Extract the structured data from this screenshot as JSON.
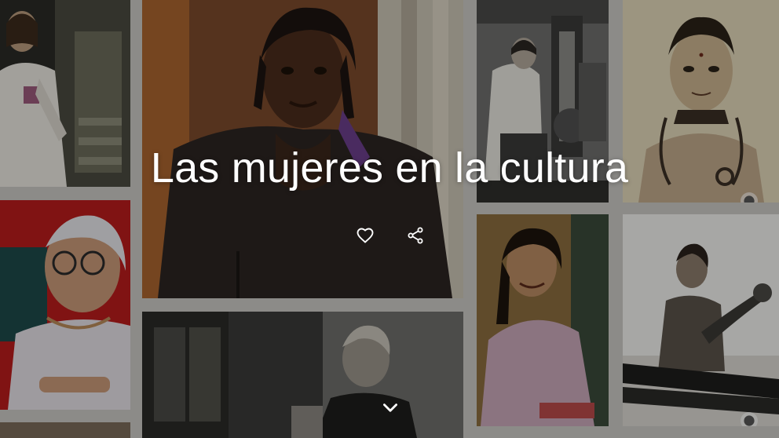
{
  "hero": {
    "title": "Las mujeres en la cultura"
  },
  "actions": {
    "favorite_icon": "heart-outline-icon",
    "share_icon": "share-icon",
    "expand_icon": "chevron-down-icon"
  },
  "colors": {
    "title_text": "#ffffff",
    "overlay": "rgba(0,0,0,0.30)",
    "gutter": "#c9c7c3"
  }
}
